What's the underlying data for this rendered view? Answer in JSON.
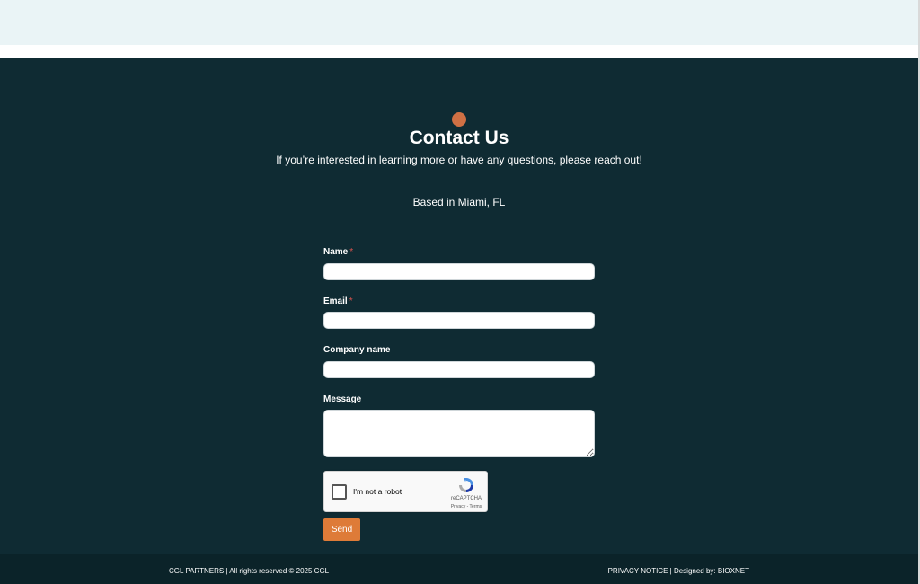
{
  "contact": {
    "title": "Contact Us",
    "subtitle": "If you’re interested in learning more or have any questions, please reach out!",
    "location": "Based in Miami, FL"
  },
  "form": {
    "name_label": "Name",
    "email_label": "Email",
    "company_label": "Company name",
    "message_label": "Message",
    "required_marker": "*",
    "name_value": "",
    "email_value": "",
    "company_value": "",
    "message_value": "",
    "send_label": "Send"
  },
  "captcha": {
    "label": "I'm not a robot",
    "brand": "reCAPTCHA",
    "links": "Privacy - Terms",
    "icon": "recaptcha-icon"
  },
  "footer": {
    "left_text": "CGL PARTNERS | All rights reserved © 2025 CGL",
    "privacy_link": "PRIVACY NOTICE",
    "designed_by": "| Designed by: BIOXNET"
  },
  "colors": {
    "background": "#0f2b33",
    "accent_dot": "#cf7044",
    "send_button": "#de7b38",
    "footer": "#0b2329",
    "top_band": "#eaf4f6"
  }
}
